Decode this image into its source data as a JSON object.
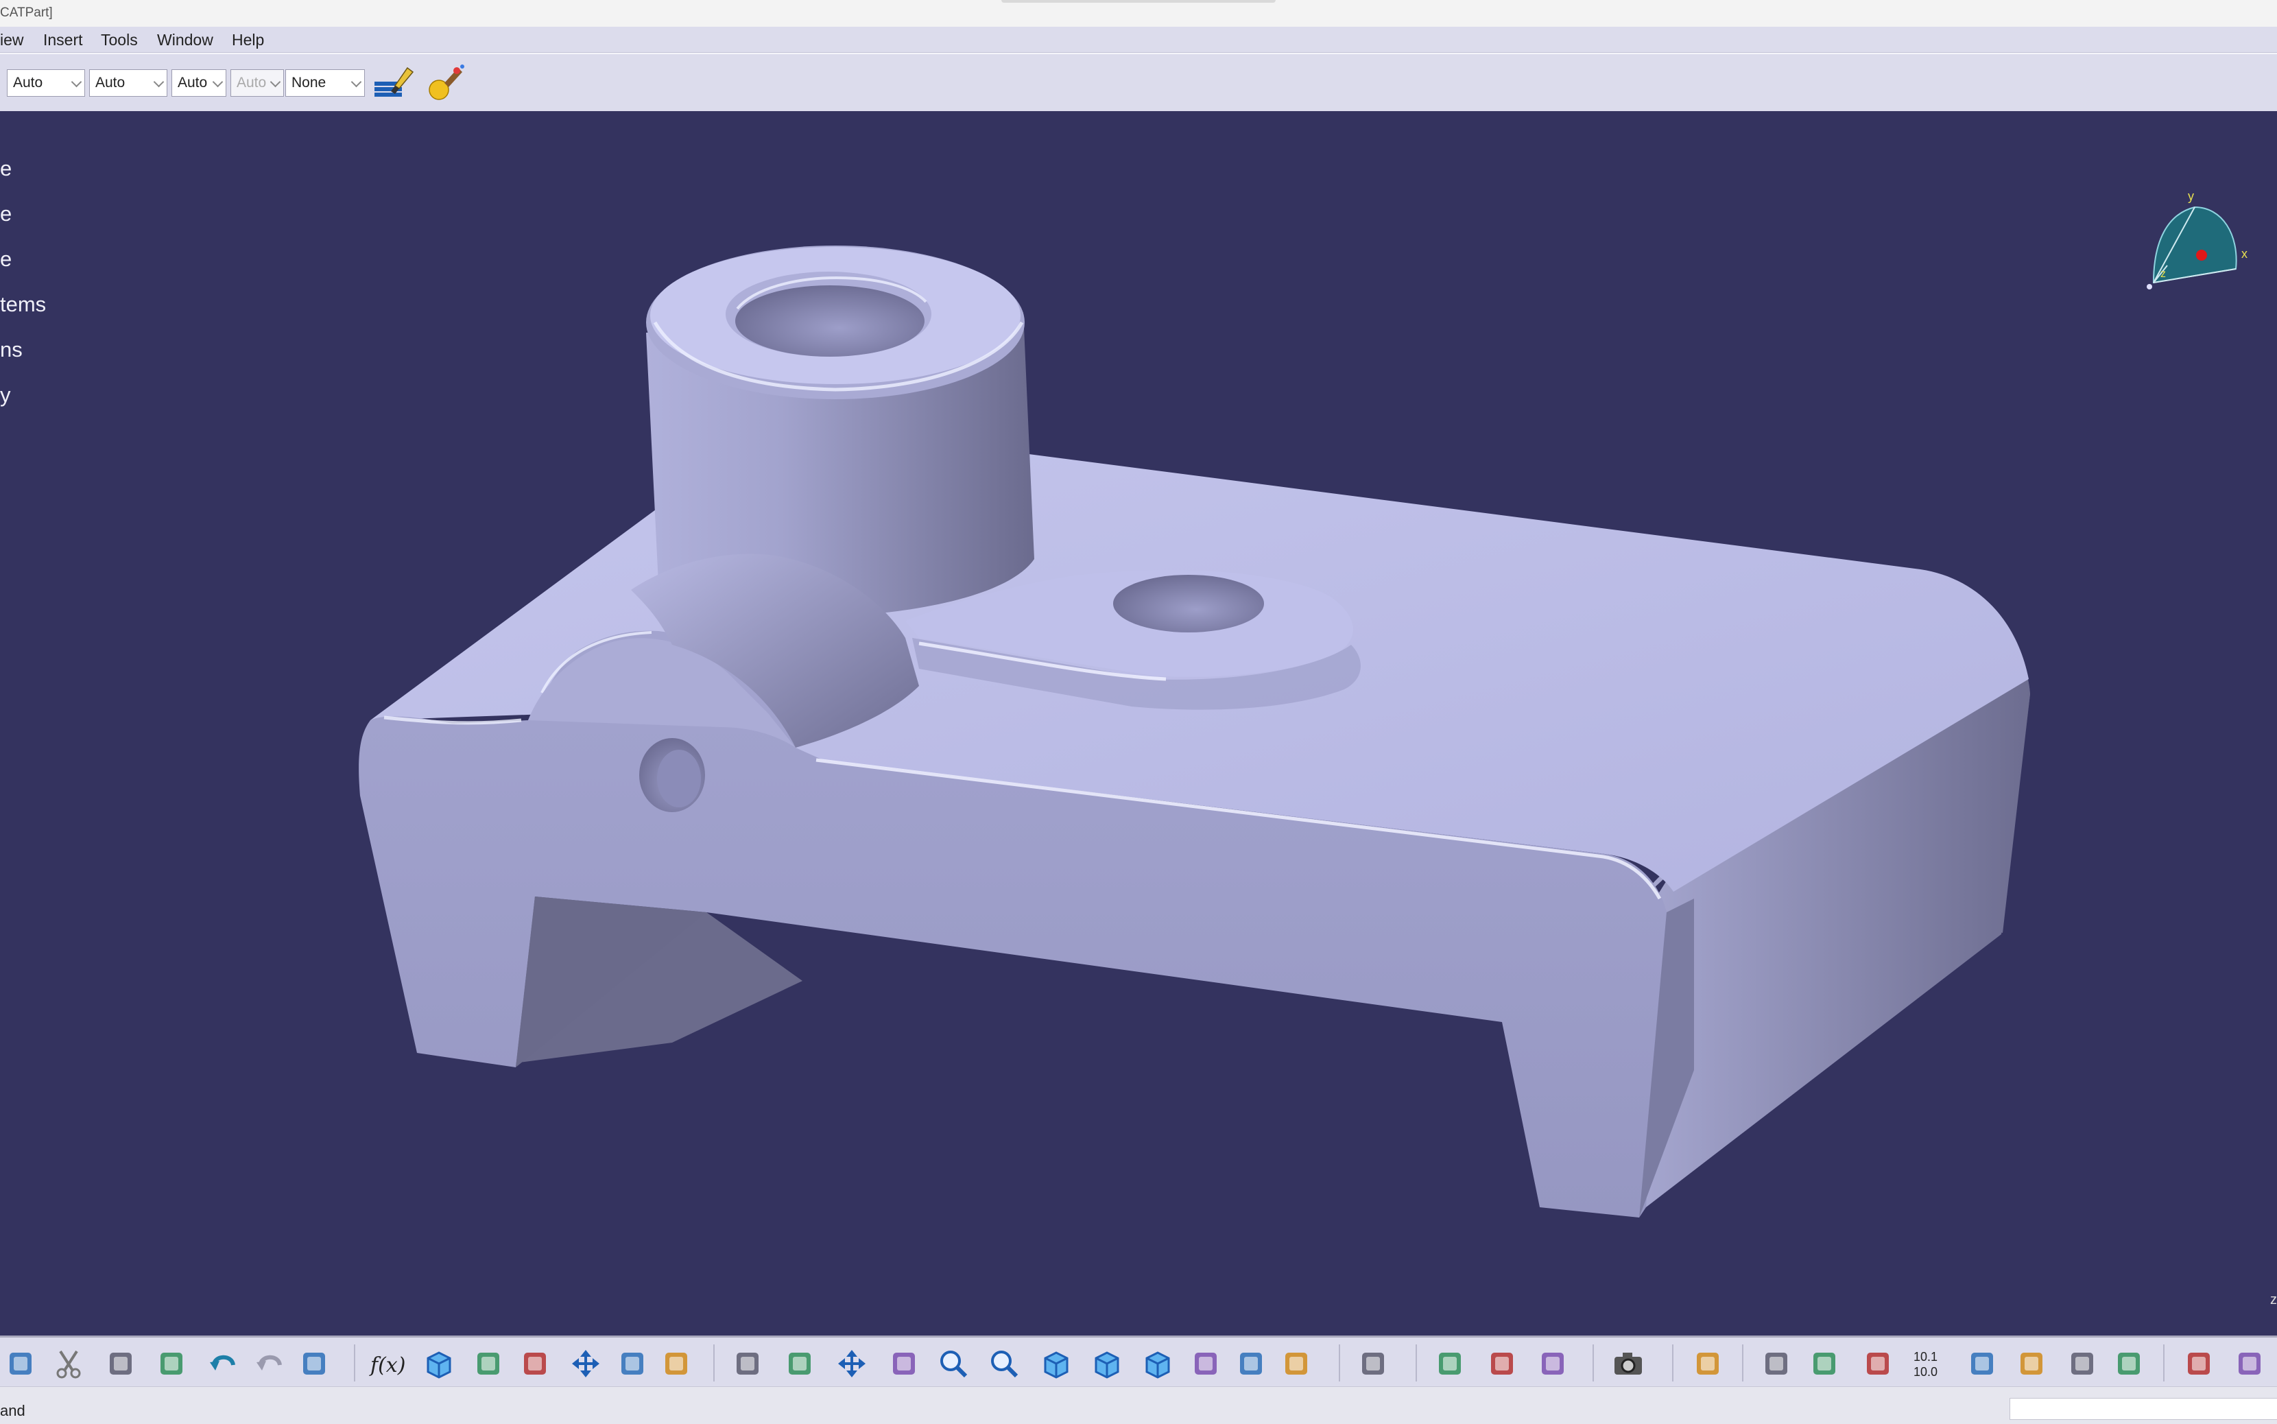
{
  "window": {
    "title": "CATPart]"
  },
  "menu": [
    "iew",
    "Insert",
    "Tools",
    "Window",
    "Help"
  ],
  "toolbar": {
    "combos": [
      {
        "value": "Auto",
        "disabled": false
      },
      {
        "value": "Auto",
        "disabled": false
      },
      {
        "value": "Auto",
        "disabled": false
      },
      {
        "value": "Auto",
        "disabled": true
      },
      {
        "value": "None",
        "disabled": false
      }
    ],
    "icons": [
      "paint-brush-icon",
      "apply-material-icon"
    ]
  },
  "tree": [
    "e",
    "e",
    "e",
    "tems",
    "ns",
    "y"
  ],
  "compass": {
    "x": "x",
    "y": "y",
    "z": "z"
  },
  "viewport": {
    "corner": "z"
  },
  "bottom_toolbar": {
    "icons": [
      "print-icon",
      "cut-icon",
      "copy-icon",
      "paste-icon",
      "undo-icon",
      "redo-icon",
      "whats-this-icon",
      "formula-icon",
      "knowledge-advisor-icon",
      "parameter-icon",
      "design-table-icon",
      "tree-expand-icon",
      "lock-icon",
      "macro-icon",
      "fly-mode-icon",
      "fit-all-icon",
      "pan-icon",
      "rotate-icon",
      "zoom-in-icon",
      "zoom-out-icon",
      "normal-view-icon",
      "multi-view-icon",
      "iso-view-icon",
      "shading-icon",
      "hide-show-icon",
      "swap-visible-icon",
      "scan-icon",
      "measure-between-icon",
      "measure-item-icon",
      "measure-inertia-icon",
      "capture-icon",
      "3d-annotation-icon",
      "catalog-icon",
      "compass-icon",
      "axis-system-icon",
      "number-format-icon",
      "sketch-icon",
      "constraint-icon",
      "stack-icon",
      "plane-icon",
      "pad-icon",
      "pocket-icon"
    ]
  },
  "status": {
    "message": "and"
  },
  "colors": {
    "background": "#34335f",
    "part": "#b4b6e0",
    "toolbar": "#dcdcec"
  }
}
